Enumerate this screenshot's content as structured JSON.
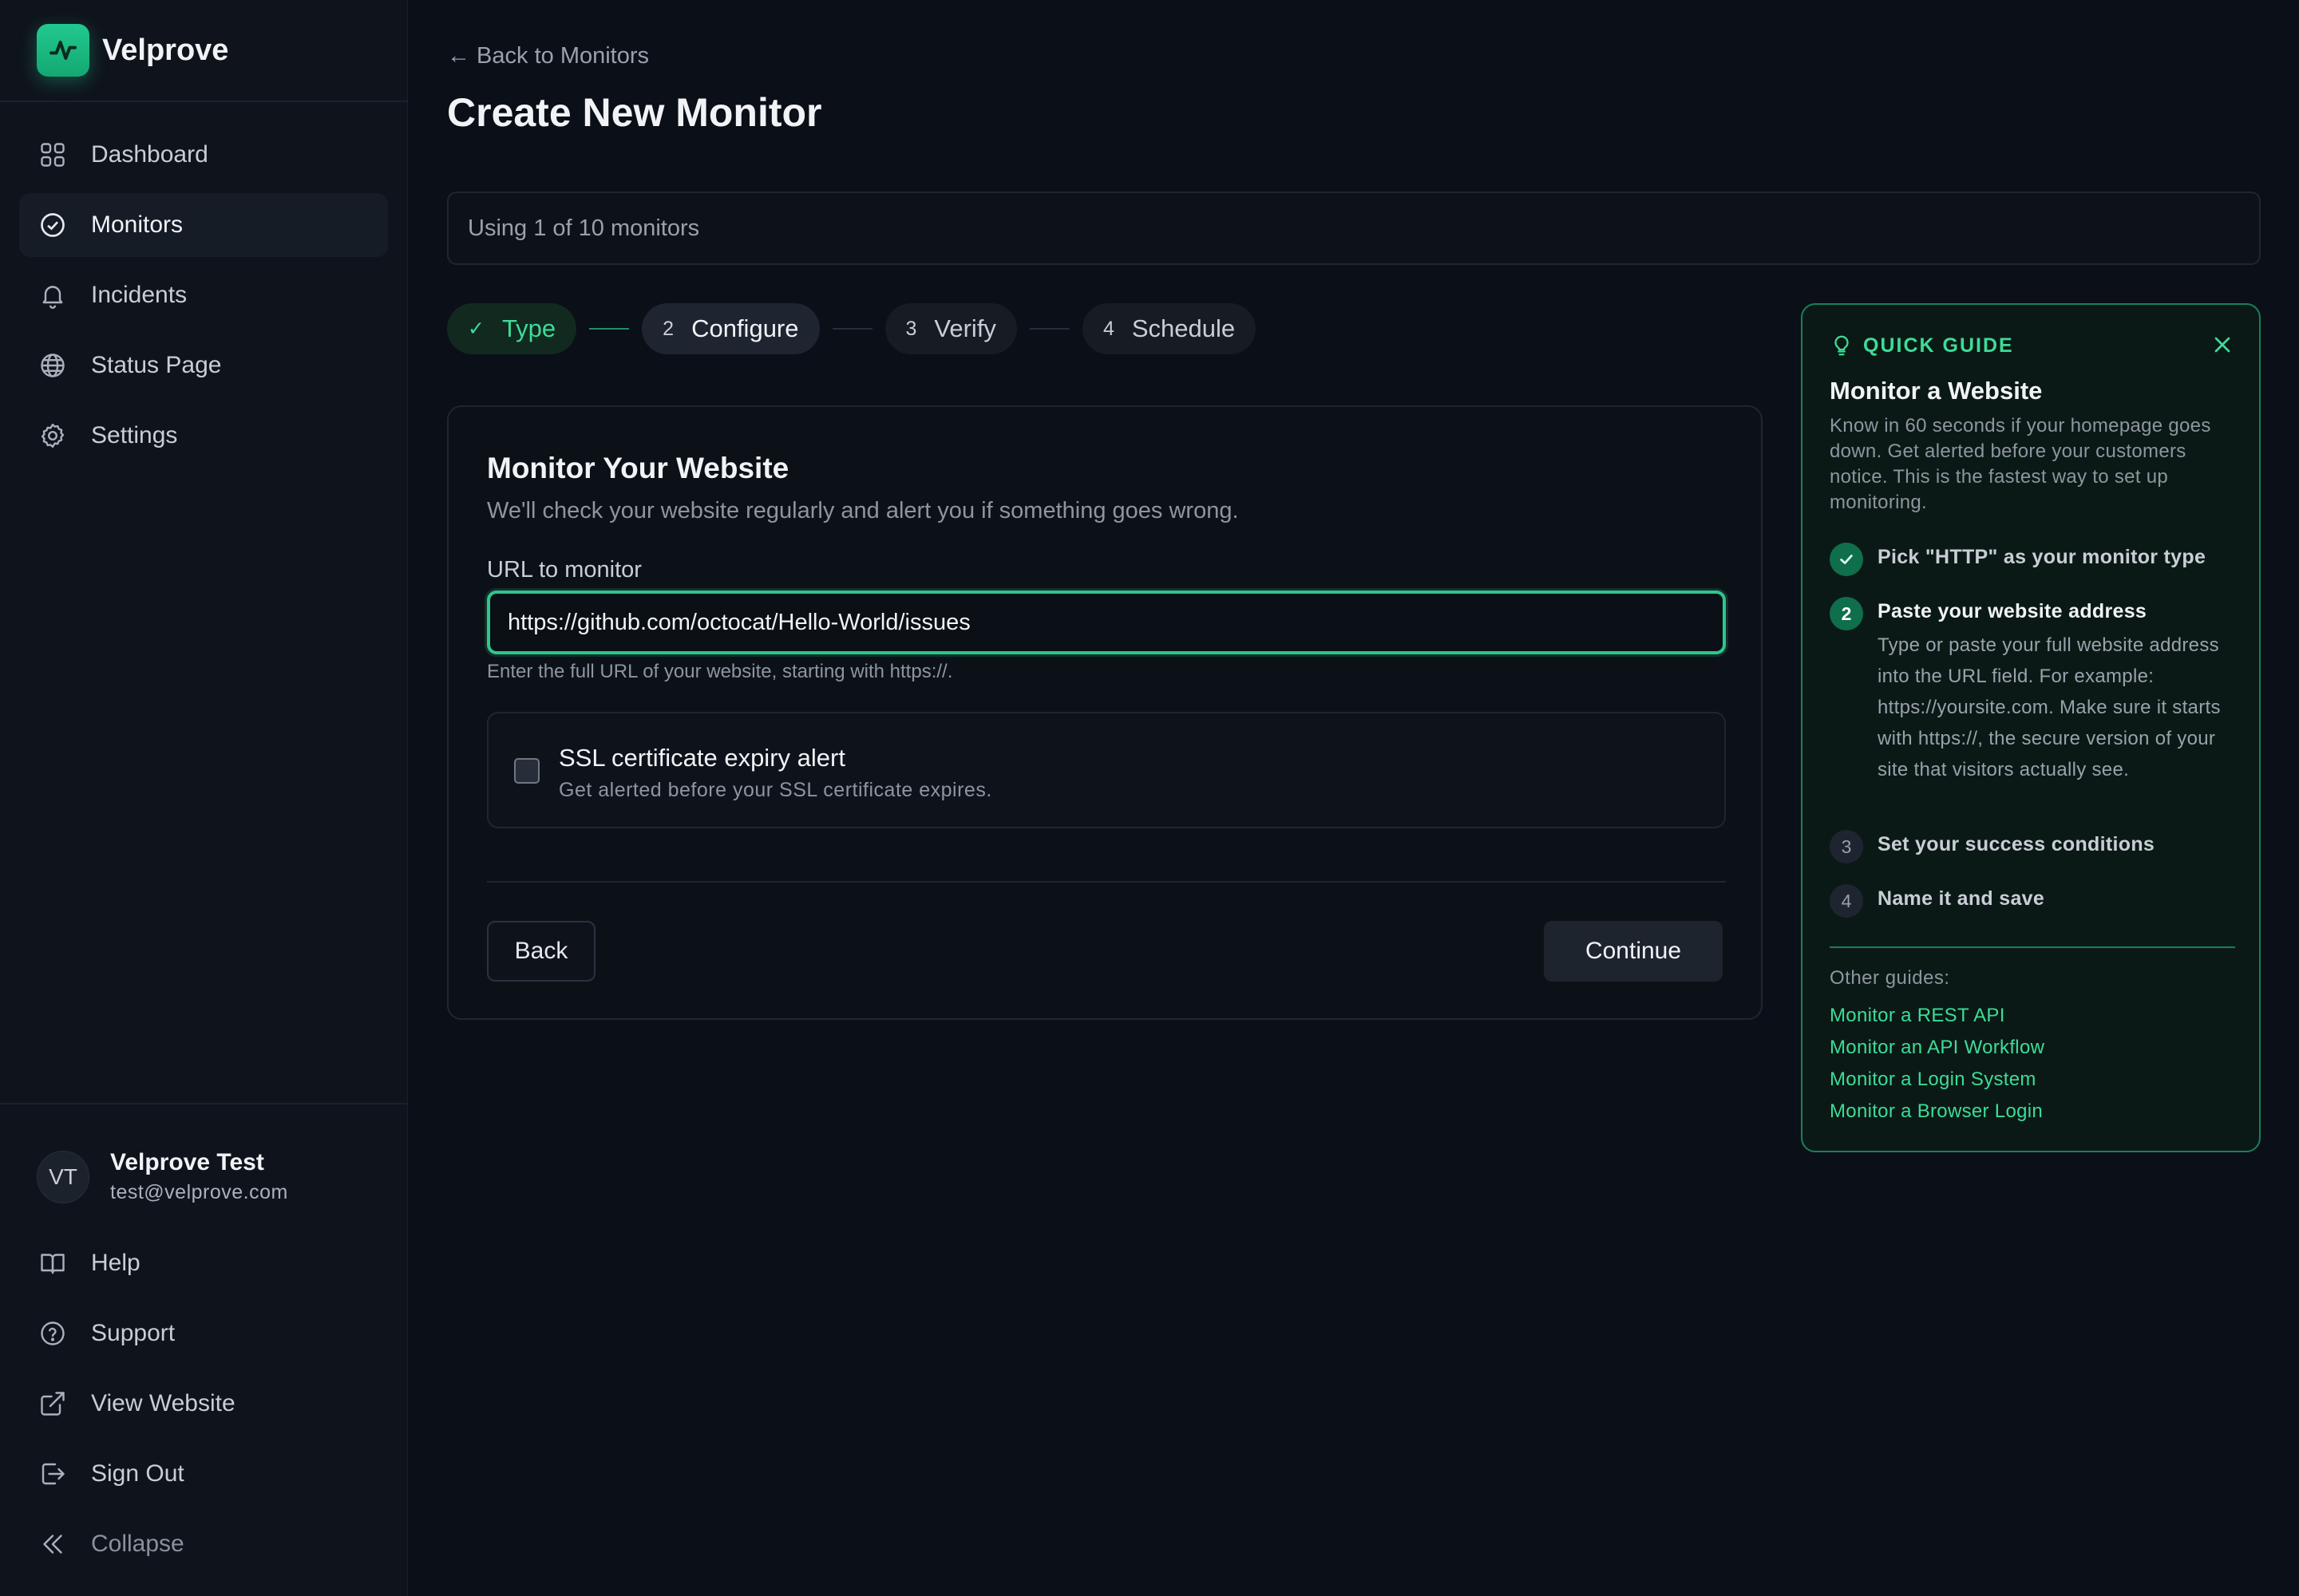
{
  "app": {
    "name": "Velprove"
  },
  "sidebar": {
    "nav": [
      {
        "label": "Dashboard",
        "icon": "grid-icon",
        "active": false
      },
      {
        "label": "Monitors",
        "icon": "check-circle-icon",
        "active": true
      },
      {
        "label": "Incidents",
        "icon": "bell-icon",
        "active": false
      },
      {
        "label": "Status Page",
        "icon": "globe-icon",
        "active": false
      },
      {
        "label": "Settings",
        "icon": "gear-icon",
        "active": false
      }
    ],
    "user": {
      "initials": "VT",
      "name": "Velprove Test",
      "email": "test@velprove.com"
    },
    "bottom": [
      {
        "label": "Help",
        "icon": "book-icon"
      },
      {
        "label": "Support",
        "icon": "help-circle-icon"
      },
      {
        "label": "View Website",
        "icon": "external-link-icon"
      },
      {
        "label": "Sign Out",
        "icon": "sign-out-icon"
      },
      {
        "label": "Collapse",
        "icon": "chevrons-left-icon"
      }
    ]
  },
  "header": {
    "back_link": "← Back to Monitors",
    "title": "Create New Monitor"
  },
  "usage": {
    "text": "Using 1 of 10 monitors"
  },
  "stepper": {
    "steps": [
      {
        "num": "✓",
        "label": "Type",
        "state": "done"
      },
      {
        "num": "2",
        "label": "Configure",
        "state": "current"
      },
      {
        "num": "3",
        "label": "Verify",
        "state": "todo"
      },
      {
        "num": "4",
        "label": "Schedule",
        "state": "todo"
      }
    ]
  },
  "form": {
    "title": "Monitor Your Website",
    "subtitle": "We'll check your website regularly and alert you if something goes wrong.",
    "url_label": "URL to monitor",
    "url_value": "https://github.com/octocat/Hello-World/issues",
    "url_hint": "Enter the full URL of your website, starting with https://.",
    "ssl_title": "SSL certificate expiry alert",
    "ssl_subtitle": "Get alerted before your SSL certificate expires.",
    "ssl_checked": false,
    "back_label": "Back",
    "continue_label": "Continue"
  },
  "guide": {
    "heading": "QUICK GUIDE",
    "title": "Monitor a Website",
    "description": "Know in 60 seconds if your homepage goes down. Get alerted before your customers notice. This is the fastest way to set up monitoring.",
    "steps": [
      {
        "badge": "✓",
        "title": "Pick \"HTTP\" as your monitor type",
        "state": "done"
      },
      {
        "badge": "2",
        "title": "Paste your website address",
        "state": "current",
        "detail": "Type or paste your full website address into the URL field. For example: https://yoursite.com. Make sure it starts with https://, the secure version of your site that visitors actually see."
      },
      {
        "badge": "3",
        "title": "Set your success conditions",
        "state": "todo"
      },
      {
        "badge": "4",
        "title": "Name it and save",
        "state": "todo"
      }
    ],
    "other_label": "Other guides:",
    "other_guides": [
      "Monitor a REST API",
      "Monitor an API Workflow",
      "Monitor a Login System",
      "Monitor a Browser Login"
    ]
  },
  "colors": {
    "accent": "#3ddc97",
    "accent_border": "#17805a",
    "background": "#0b0f17",
    "sidebar": "#0f141c"
  }
}
